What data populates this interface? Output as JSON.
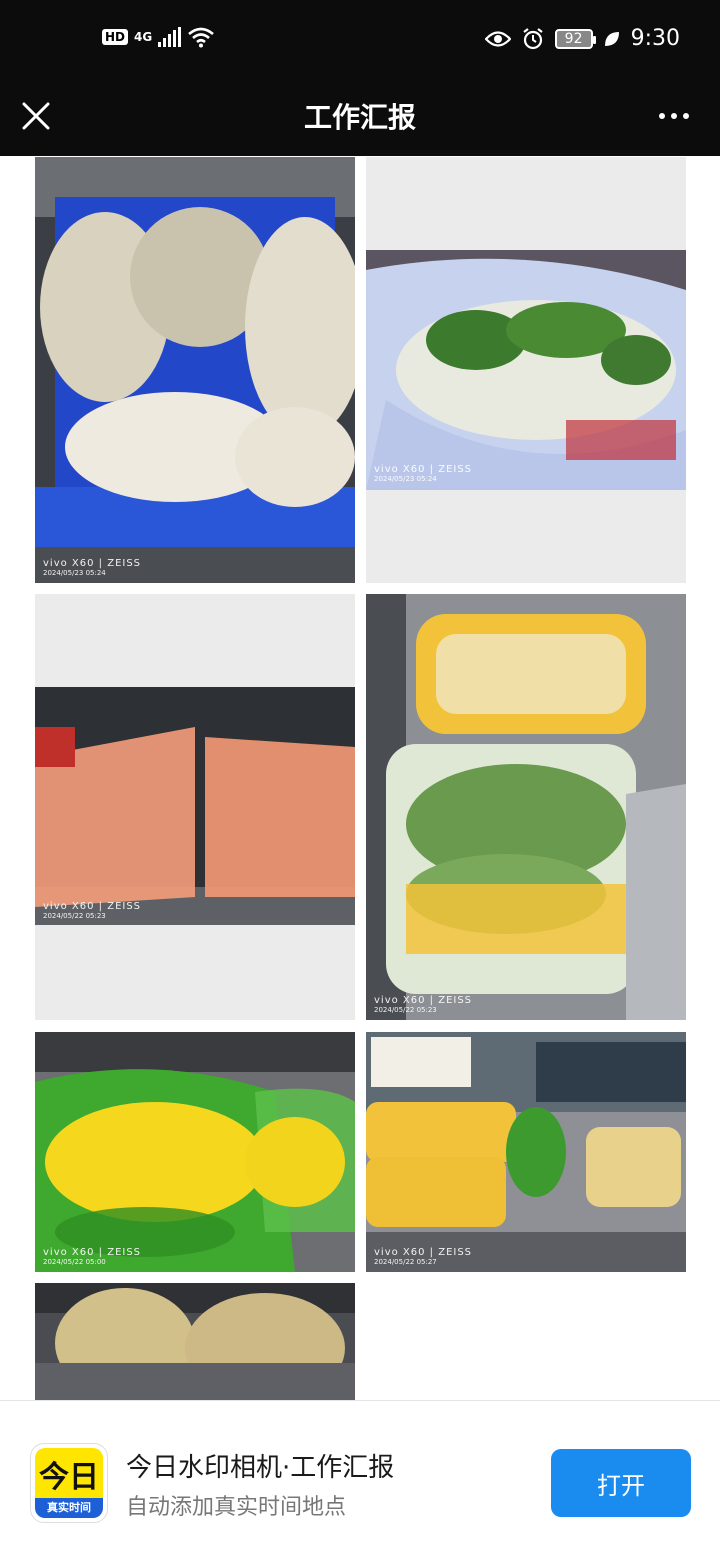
{
  "status_bar": {
    "hd_label": "HD",
    "network_label": "4G",
    "battery_level": "92",
    "time": "9:30"
  },
  "header": {
    "title": "工作汇报"
  },
  "photos": [
    {
      "camera": "vivo X60 | ZEISS",
      "date": "2024/05/23 05:24",
      "subject": "blue crate with bagged tofu"
    },
    {
      "camera": "vivo X60 | ZEISS",
      "date": "2024/05/23 05:24",
      "subject": "radishes in blue bag"
    },
    {
      "camera": "vivo X60 | ZEISS",
      "date": "2024/05/22 05:23",
      "subject": "bagged carrots"
    },
    {
      "camera": "vivo X60 | ZEISS",
      "date": "2024/05/22 05:23",
      "subject": "wrapped napa cabbage"
    },
    {
      "camera": "vivo X60 | ZEISS",
      "date": "2024/05/22 05:00",
      "subject": "corn in green bag"
    },
    {
      "camera": "vivo X60 | ZEISS",
      "date": "2024/05/22 05:27",
      "subject": "wrapped vegetable sacks"
    },
    {
      "camera": "",
      "date": "",
      "subject": "bagged potatoes"
    }
  ],
  "banner": {
    "icon_text": "今日",
    "icon_subtext": "真实时间",
    "app_name": "今日水印相机·工作汇报",
    "app_desc": "自动添加真实时间地点",
    "open_label": "打开"
  },
  "colors": {
    "bar_bg": "#0c0c0c",
    "accent": "#1a8cf0",
    "icon_yellow": "#ffe600"
  }
}
